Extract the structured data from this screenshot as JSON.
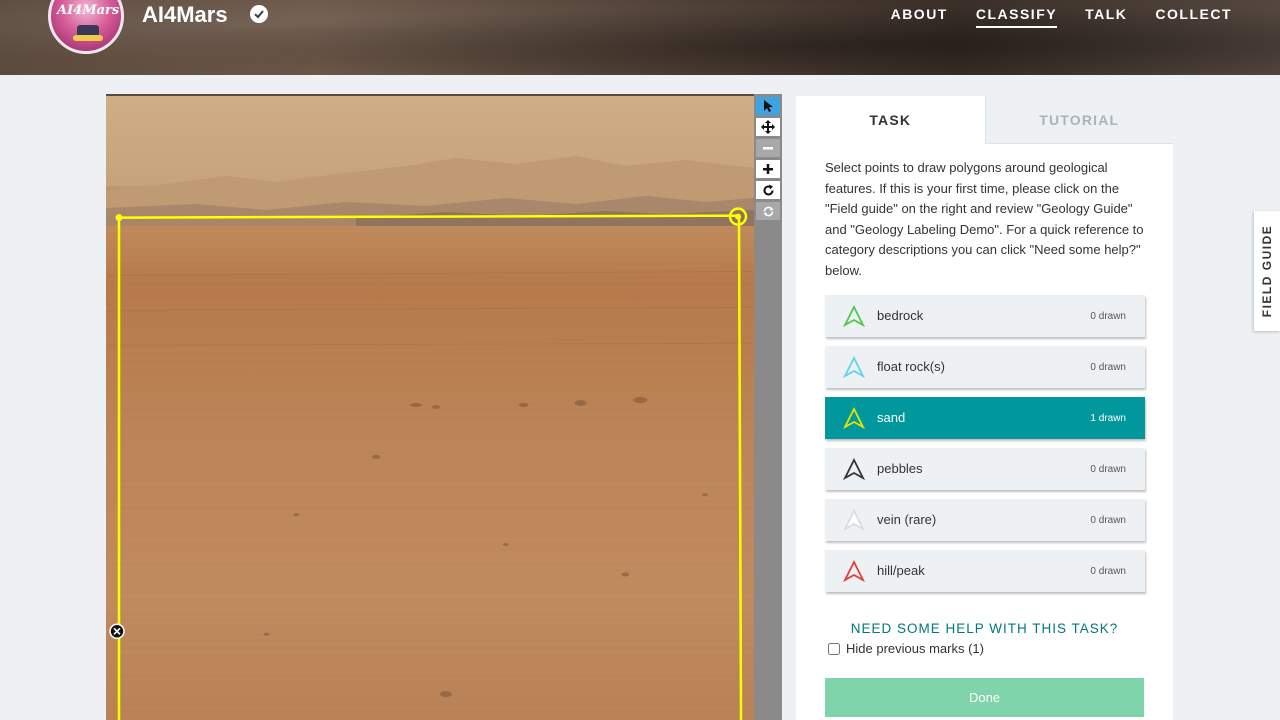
{
  "header": {
    "logo_text": "AI4Mars",
    "project_title": "AI4Mars",
    "nav": [
      {
        "label": "ABOUT",
        "active": false
      },
      {
        "label": "CLASSIFY",
        "active": true
      },
      {
        "label": "TALK",
        "active": false
      },
      {
        "label": "COLLECT",
        "active": false
      }
    ]
  },
  "viewer": {
    "tools": [
      "pointer-icon",
      "move-icon",
      "zoom-out-icon",
      "zoom-in-icon",
      "rotate-icon",
      "reset-icon"
    ]
  },
  "panel": {
    "tabs": [
      {
        "label": "TASK",
        "active": true
      },
      {
        "label": "TUTORIAL",
        "active": false
      }
    ],
    "instructions": "Select points to draw polygons around geological features. If this is your first time, please click on the \"Field guide\" on the right and review \"Geology Guide\" and \"Geology Labeling Demo\". For a quick reference to category descriptions you can click \"Need some help?\" below.",
    "answers": [
      {
        "label": "bedrock",
        "count": "0 drawn",
        "color": "#4cc94c",
        "selected": false
      },
      {
        "label": "float rock(s)",
        "count": "0 drawn",
        "color": "#5fd3e8",
        "selected": false
      },
      {
        "label": "sand",
        "count": "1 drawn",
        "color": "#e6e600",
        "selected": true
      },
      {
        "label": "pebbles",
        "count": "0 drawn",
        "color": "#333333",
        "selected": false
      },
      {
        "label": "vein (rare)",
        "count": "0 drawn",
        "color": "#d8dde2",
        "selected": false
      },
      {
        "label": "hill/peak",
        "count": "0 drawn",
        "color": "#e0403a",
        "selected": false
      }
    ],
    "help_link": "NEED SOME HELP WITH THIS TASK?",
    "hide_marks_label": "Hide previous marks (1)",
    "done_label": "Done"
  },
  "field_guide_label": "FIELD GUIDE"
}
